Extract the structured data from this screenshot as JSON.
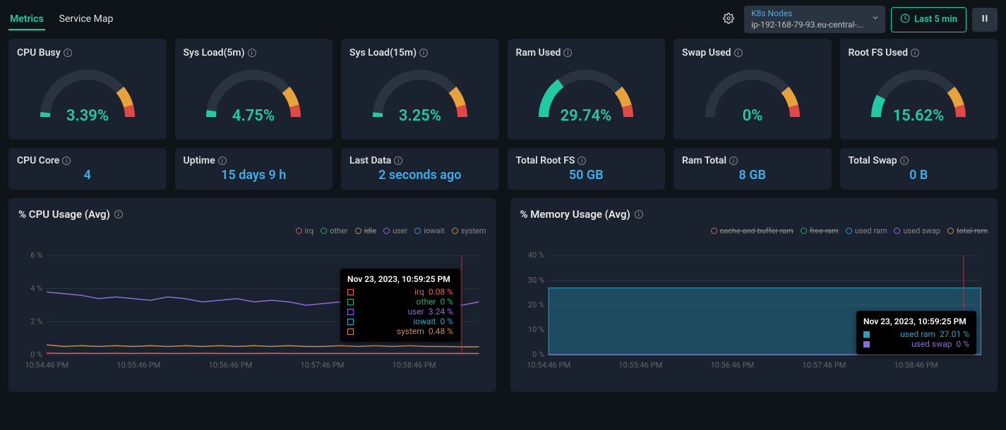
{
  "tabs": {
    "metrics": "Metrics",
    "serviceMap": "Service Map"
  },
  "header": {
    "selectorLabel": "K8s Nodes",
    "selectorValue": "ip-192-168-79-93.eu-central-...",
    "timeRange": "Last 5 min"
  },
  "gauges": [
    {
      "title": "CPU Busy",
      "value": 3.39,
      "display": "3.39%"
    },
    {
      "title": "Sys Load(5m)",
      "value": 4.75,
      "display": "4.75%"
    },
    {
      "title": "Sys Load(15m)",
      "value": 3.25,
      "display": "3.25%"
    },
    {
      "title": "Ram Used",
      "value": 29.74,
      "display": "29.74%"
    },
    {
      "title": "Swap Used",
      "value": 0,
      "display": "0%"
    },
    {
      "title": "Root FS Used",
      "value": 15.62,
      "display": "15.62%"
    }
  ],
  "stats": [
    {
      "title": "CPU Core",
      "value": "4"
    },
    {
      "title": "Uptime",
      "value": "15 days 9 h"
    },
    {
      "title": "Last Data",
      "value": "2 seconds ago"
    },
    {
      "title": "Total Root FS",
      "value": "50 GB"
    },
    {
      "title": "Ram Total",
      "value": "8 GB"
    },
    {
      "title": "Total Swap",
      "value": "0 B"
    }
  ],
  "chart_data": [
    {
      "type": "line",
      "title": "% CPU Usage (Avg)",
      "xlabel": "",
      "ylabel": "",
      "ylim": [
        0,
        6
      ],
      "yunit": "%",
      "x_ticks": [
        "10:54:46 PM",
        "10:55:46 PM",
        "10:56:46 PM",
        "10:57:46 PM",
        "10:58:46 PM"
      ],
      "series": [
        {
          "name": "irq",
          "color": "#e05d5d",
          "active": true
        },
        {
          "name": "other",
          "color": "#2aa36f",
          "active": true
        },
        {
          "name": "idle",
          "color": "#a69b3d",
          "active": false
        },
        {
          "name": "user",
          "color": "#8e6bd9",
          "active": true
        },
        {
          "name": "iowait",
          "color": "#2aa0c4",
          "active": true
        },
        {
          "name": "system",
          "color": "#c98a4a",
          "active": true
        }
      ],
      "tooltip": {
        "timestamp": "Nov 23, 2023, 10:59:25 PM",
        "rows": [
          {
            "name": "irq",
            "value": "0.08 %",
            "color": "#e05d5d"
          },
          {
            "name": "other",
            "value": "0 %",
            "color": "#2aa36f"
          },
          {
            "name": "user",
            "value": "3.24 %",
            "color": "#8e6bd9"
          },
          {
            "name": "iowait",
            "value": "0 %",
            "color": "#2aa0c4"
          },
          {
            "name": "system",
            "value": "0.48 %",
            "color": "#c98a4a"
          }
        ]
      },
      "sampled": {
        "user": [
          3.8,
          3.7,
          3.6,
          3.4,
          3.5,
          3.4,
          3.3,
          3.5,
          3.4,
          3.2,
          3.3,
          3.4,
          3.2,
          3.3,
          3.2,
          3.0,
          3.1,
          3.2,
          3.0,
          3.2,
          3.0,
          3.1,
          3.0,
          3.2,
          3.0,
          3.2
        ],
        "system": [
          0.6,
          0.5,
          0.55,
          0.5,
          0.55,
          0.5,
          0.55,
          0.5,
          0.55,
          0.5,
          0.55,
          0.5,
          0.55,
          0.5,
          0.55,
          0.5,
          0.5,
          0.55,
          0.5,
          0.55,
          0.5,
          0.55,
          0.5,
          0.5,
          0.48,
          0.48
        ],
        "irq": [
          0.1,
          0.08,
          0.09,
          0.08,
          0.09,
          0.08,
          0.09,
          0.08,
          0.08,
          0.09,
          0.08,
          0.08,
          0.08,
          0.09,
          0.08,
          0.08,
          0.08,
          0.08,
          0.08,
          0.08,
          0.08,
          0.08,
          0.08,
          0.08,
          0.08,
          0.08
        ]
      }
    },
    {
      "type": "area",
      "title": "% Memory Usage (Avg)",
      "xlabel": "",
      "ylabel": "",
      "ylim": [
        0,
        40
      ],
      "yunit": "%",
      "x_ticks": [
        "10:54:46 PM",
        "10:55:46 PM",
        "10:56:46 PM",
        "10:57:46 PM",
        "10:58:46 PM"
      ],
      "series": [
        {
          "name": "cache and buffer ram",
          "color": "#e05d5d",
          "active": false
        },
        {
          "name": "free ram",
          "color": "#2aa36f",
          "active": false
        },
        {
          "name": "used ram",
          "color": "#2aa0c4",
          "active": true
        },
        {
          "name": "used swap",
          "color": "#8e6bd9",
          "active": true
        },
        {
          "name": "total ram",
          "color": "#c98a4a",
          "active": false
        }
      ],
      "tooltip": {
        "timestamp": "Nov 23, 2023, 10:59:25 PM",
        "rows": [
          {
            "name": "used ram",
            "value": "27.01 %",
            "color": "#2aa0c4"
          },
          {
            "name": "used swap",
            "value": "0 %",
            "color": "#8e6bd9"
          }
        ]
      },
      "sampled": {
        "used_ram": [
          27,
          27,
          27,
          27,
          27,
          27,
          27,
          27,
          27,
          27,
          27,
          27,
          27,
          27,
          27,
          27,
          27,
          27,
          27,
          27,
          27,
          27,
          27,
          27,
          27,
          27
        ],
        "used_swap": [
          0,
          0,
          0,
          0,
          0,
          0,
          0,
          0,
          0,
          0,
          0,
          0,
          0,
          0,
          0,
          0,
          0,
          0,
          0,
          0,
          0,
          0,
          0,
          0,
          0,
          0
        ]
      }
    }
  ]
}
